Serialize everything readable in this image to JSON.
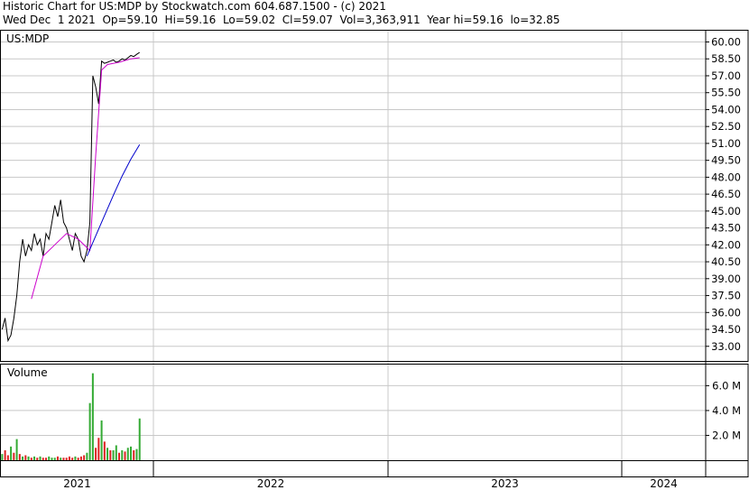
{
  "header": {
    "line1": "Historic Chart for US:MDP by Stockwatch.com 604.687.1500 - (c) 2021",
    "line2": "Wed Dec  1 2021  Op=59.10  Hi=59.16  Lo=59.02  Cl=59.07  Vol=3,363,911  Year hi=59.16  lo=32.85"
  },
  "chart_data": {
    "type": "line",
    "symbol_label": "US:MDP",
    "volume_label": "Volume",
    "price_axis": {
      "ylim": [
        31.7,
        61.0
      ],
      "ticks": [
        "60.00",
        "58.50",
        "57.00",
        "55.50",
        "54.00",
        "52.50",
        "51.00",
        "49.50",
        "48.00",
        "46.50",
        "45.00",
        "43.50",
        "42.00",
        "40.50",
        "39.00",
        "37.50",
        "36.00",
        "34.50",
        "33.00"
      ]
    },
    "volume_axis": {
      "ylim": [
        0,
        7.7
      ],
      "ticks": [
        "6.0 M",
        "4.0 M",
        "2.0 M"
      ]
    },
    "x_axis": {
      "labels": [
        "2021",
        "2022",
        "2023",
        "2024"
      ]
    },
    "grid": true,
    "colors": {
      "price": "#000000",
      "ma_short": "#cc00cc",
      "ma_long": "#0000cc",
      "vol_up": "#33aa33",
      "vol_down": "#dd2222",
      "grid": "#c8c8c8",
      "frame": "#000000"
    },
    "series": [
      {
        "role": "price",
        "x": [
          "2021-01-04",
          "2021-01-11",
          "2021-01-18",
          "2021-01-25",
          "2021-02-01",
          "2021-02-08",
          "2021-02-15",
          "2021-02-22",
          "2021-03-01",
          "2021-03-08",
          "2021-03-15",
          "2021-03-22",
          "2021-03-29",
          "2021-04-05",
          "2021-04-12",
          "2021-04-19",
          "2021-04-26",
          "2021-05-03",
          "2021-05-10",
          "2021-05-17",
          "2021-05-24",
          "2021-05-31",
          "2021-06-07",
          "2021-06-14",
          "2021-06-21",
          "2021-06-28",
          "2021-07-05",
          "2021-07-12",
          "2021-07-19",
          "2021-07-26",
          "2021-08-02",
          "2021-08-09",
          "2021-08-16",
          "2021-08-23",
          "2021-08-30",
          "2021-09-06",
          "2021-09-13",
          "2021-09-20",
          "2021-09-27",
          "2021-10-04",
          "2021-10-11",
          "2021-10-18",
          "2021-10-25",
          "2021-11-01",
          "2021-11-08",
          "2021-11-15",
          "2021-11-22",
          "2021-11-29"
        ],
        "values": [
          34.5,
          35.5,
          33.5,
          34.0,
          35.5,
          37.5,
          40.5,
          42.5,
          41.0,
          42.0,
          41.5,
          43.0,
          42.0,
          42.5,
          41.0,
          43.0,
          42.5,
          44.0,
          45.5,
          44.5,
          46.0,
          44.0,
          43.5,
          42.5,
          41.5,
          43.0,
          42.5,
          41.0,
          40.5,
          41.5,
          44.0,
          57.0,
          56.0,
          54.5,
          58.3,
          58.1,
          58.2,
          58.3,
          58.4,
          58.2,
          58.3,
          58.5,
          58.4,
          58.6,
          58.8,
          58.7,
          58.9,
          59.07
        ]
      },
      {
        "role": "ma_short",
        "x": [
          "2021-03-15",
          "2021-04-12",
          "2021-05-10",
          "2021-06-07",
          "2021-07-05",
          "2021-08-02",
          "2021-08-16",
          "2021-08-30",
          "2021-09-13",
          "2021-10-11",
          "2021-11-08",
          "2021-11-29"
        ],
        "values": [
          37.2,
          41.0,
          42.0,
          43.0,
          42.5,
          41.5,
          50.0,
          57.5,
          58.0,
          58.2,
          58.5,
          58.6
        ]
      },
      {
        "role": "ma_long",
        "x": [
          "2021-07-26",
          "2021-08-16",
          "2021-09-06",
          "2021-09-27",
          "2021-10-18",
          "2021-11-08",
          "2021-11-29"
        ],
        "values": [
          41.0,
          42.8,
          44.6,
          46.4,
          48.1,
          49.6,
          50.9
        ]
      },
      {
        "role": "volume",
        "unit": "M",
        "x": [
          "2021-01-04",
          "2021-01-11",
          "2021-01-18",
          "2021-01-25",
          "2021-02-01",
          "2021-02-08",
          "2021-02-15",
          "2021-02-22",
          "2021-03-01",
          "2021-03-08",
          "2021-03-15",
          "2021-03-22",
          "2021-03-29",
          "2021-04-05",
          "2021-04-12",
          "2021-04-19",
          "2021-04-26",
          "2021-05-03",
          "2021-05-10",
          "2021-05-17",
          "2021-05-24",
          "2021-05-31",
          "2021-06-07",
          "2021-06-14",
          "2021-06-21",
          "2021-06-28",
          "2021-07-05",
          "2021-07-12",
          "2021-07-19",
          "2021-07-26",
          "2021-08-02",
          "2021-08-09",
          "2021-08-16",
          "2021-08-23",
          "2021-08-30",
          "2021-09-06",
          "2021-09-13",
          "2021-09-20",
          "2021-09-27",
          "2021-10-04",
          "2021-10-11",
          "2021-10-18",
          "2021-10-25",
          "2021-11-01",
          "2021-11-08",
          "2021-11-15",
          "2021-11-22",
          "2021-11-29"
        ],
        "values": [
          0.5,
          0.8,
          0.4,
          1.1,
          0.6,
          1.7,
          0.5,
          0.3,
          0.4,
          0.3,
          0.2,
          0.3,
          0.2,
          0.3,
          0.2,
          0.2,
          0.3,
          0.2,
          0.2,
          0.3,
          0.2,
          0.2,
          0.2,
          0.3,
          0.2,
          0.3,
          0.2,
          0.3,
          0.4,
          0.6,
          4.6,
          7.0,
          1.0,
          1.8,
          3.2,
          1.5,
          1.0,
          0.8,
          0.8,
          1.2,
          0.6,
          0.8,
          0.7,
          1.0,
          1.1,
          0.8,
          0.9,
          3.36
        ],
        "up": [
          true,
          false,
          false,
          true,
          false,
          true,
          false,
          true,
          false,
          true,
          false,
          true,
          false,
          true,
          false,
          false,
          true,
          true,
          true,
          false,
          true,
          false,
          false,
          false,
          false,
          true,
          false,
          false,
          false,
          true,
          true,
          true,
          false,
          false,
          true,
          false,
          true,
          false,
          true,
          true,
          false,
          true,
          false,
          true,
          true,
          false,
          true,
          true
        ]
      }
    ]
  }
}
